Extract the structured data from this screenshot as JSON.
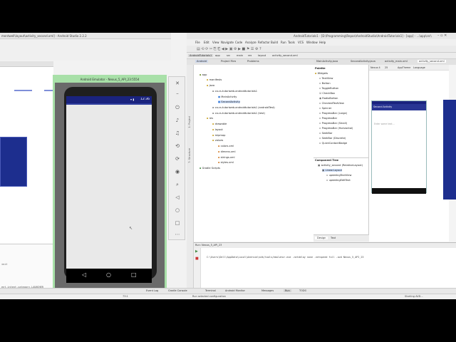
{
  "left_window": {
    "title": "mentwell\\layout\\activity_second.xml] - Android Studio 2.2.2",
    "log_line_1": "init",
    "log_line_2": "ent.intent.category.LAUNCHER",
    "status": "73:1"
  },
  "emulator": {
    "title": "Android Emulator - Nexus_5_API_23:5554",
    "clock": "12:36",
    "nav_back": "◁",
    "nav_home": "○",
    "nav_recent": "□"
  },
  "ide": {
    "title": "AndroidTutorials1 - [D:\\Programming\\Repos\\AndroidStudio\\AndroidTutorials1] - [app] - ...\\app\\src\\",
    "menu": [
      "File",
      "Edit",
      "View",
      "Navigate",
      "Code",
      "Analyze",
      "Refactor",
      "Build",
      "Run",
      "Tools",
      "VCS",
      "Window",
      "Help"
    ],
    "breadcrumb": [
      "AndroidTutorials1",
      "app",
      "src",
      "main",
      "res",
      "layout",
      "activity_second.xml"
    ],
    "project_tabs": [
      "Android",
      "Project Files",
      "Problems"
    ],
    "project_tree": [
      "app",
      "manifests",
      "java",
      "ca.cs.tutoriweb.androidtutorials1",
      "MainActivity",
      "SecondActivity",
      "ca.cs.tutoriweb.androidtutorials1 (androidTest)",
      "ca.cs.tutoriweb.androidtutorials1 (test)",
      "res",
      "drawable",
      "layout",
      "mipmap",
      "values",
      "colors.xml",
      "dimens.xml",
      "strings.xml",
      "styles.xml",
      "Gradle Scripts"
    ],
    "editor_tabs": [
      "MainActivity.java",
      "SecondActivity.java",
      "activity_main.xml",
      "activity_second.xml"
    ],
    "palette_header": "Palette",
    "palette_items": [
      "Widgets",
      "TextView",
      "Button",
      "ToggleButton",
      "CheckBox",
      "RadioButton",
      "CheckedTextView",
      "Spinner",
      "ProgressBar (Large)",
      "ProgressBar",
      "ProgressBar (Small)",
      "ProgressBar (Horizontal)",
      "SeekBar",
      "SeekBar (Discrete)",
      "QuickContactBadge"
    ],
    "component_tree_header": "Component Tree",
    "component_tree": [
      "activity_second (RelativeLayout)",
      "LinearLayout",
      "updatingTextView",
      "updatingEditText"
    ],
    "design_tabs": [
      "Design",
      "Text"
    ],
    "device_label": "Nexus 4",
    "api_label": "25",
    "theme_label": "AppTheme",
    "lang_label": "Language",
    "preview_app_title": "Second Activity",
    "preview_hint": "Enter some text...",
    "run_header": "Run: Nexus_5_API_23",
    "run_cmd": "C:\\Users\\Dell\\AppData\\Local\\Android\\sdk/tools/emulator.exe -netdelay none -netspeed full -avd Nexus_5_API_23",
    "bottom_tabs": [
      "Event Log",
      "Gradle Console",
      "Terminal",
      "Android Monitor",
      "Messages",
      "Run",
      "TODO"
    ],
    "status_text": "Run selected configuration",
    "status_right": "Starting AVD..."
  },
  "colors": {
    "primary": "#1a237e",
    "blueprint": "#1d2e8e",
    "emulator_border": "#a8e0a8"
  }
}
